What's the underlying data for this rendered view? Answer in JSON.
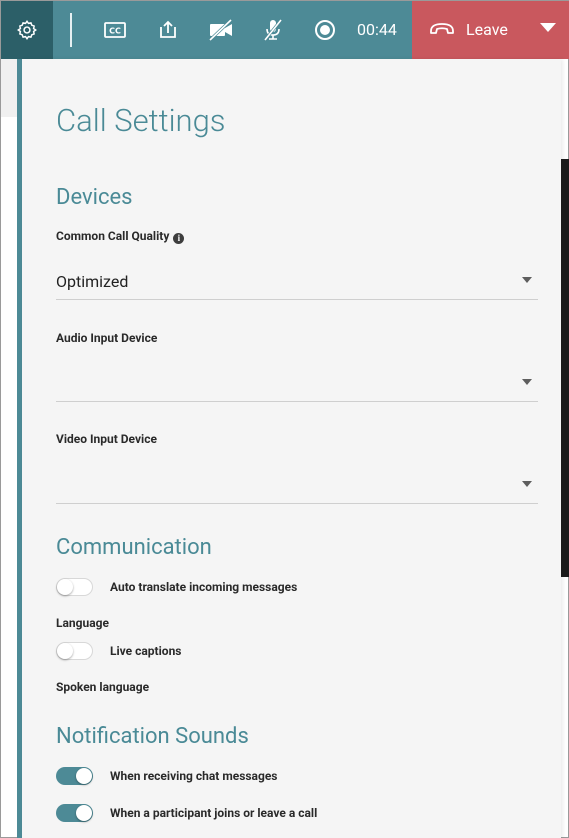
{
  "toolbar": {
    "timer": "00:44",
    "leave_label": "Leave",
    "colors": {
      "bar": "#4d8a96",
      "settings_bg": "#2c5f68",
      "leave_bg": "#c9585e"
    },
    "buttons": [
      "settings-icon",
      "closed-captions-icon",
      "share-screen-icon",
      "camera-off-icon",
      "mic-off-icon",
      "record-icon",
      "hang-up-icon",
      "caret-down-icon"
    ]
  },
  "panel": {
    "title": "Call Settings",
    "devices": {
      "heading": "Devices",
      "call_quality": {
        "label": "Common Call Quality",
        "value": "Optimized"
      },
      "audio_input": {
        "label": "Audio Input Device",
        "value": ""
      },
      "video_input": {
        "label": "Video Input Device",
        "value": ""
      }
    },
    "communication": {
      "heading": "Communication",
      "auto_translate": {
        "label": "Auto translate incoming messages",
        "on": false
      },
      "language_label": "Language",
      "live_captions": {
        "label": "Live captions",
        "on": false
      },
      "spoken_language_label": "Spoken language"
    },
    "notifications": {
      "heading": "Notification Sounds",
      "chat_messages": {
        "label": "When receiving chat messages",
        "on": true
      },
      "participant_join": {
        "label": "When a participant joins or leave a call",
        "on": true
      }
    }
  }
}
